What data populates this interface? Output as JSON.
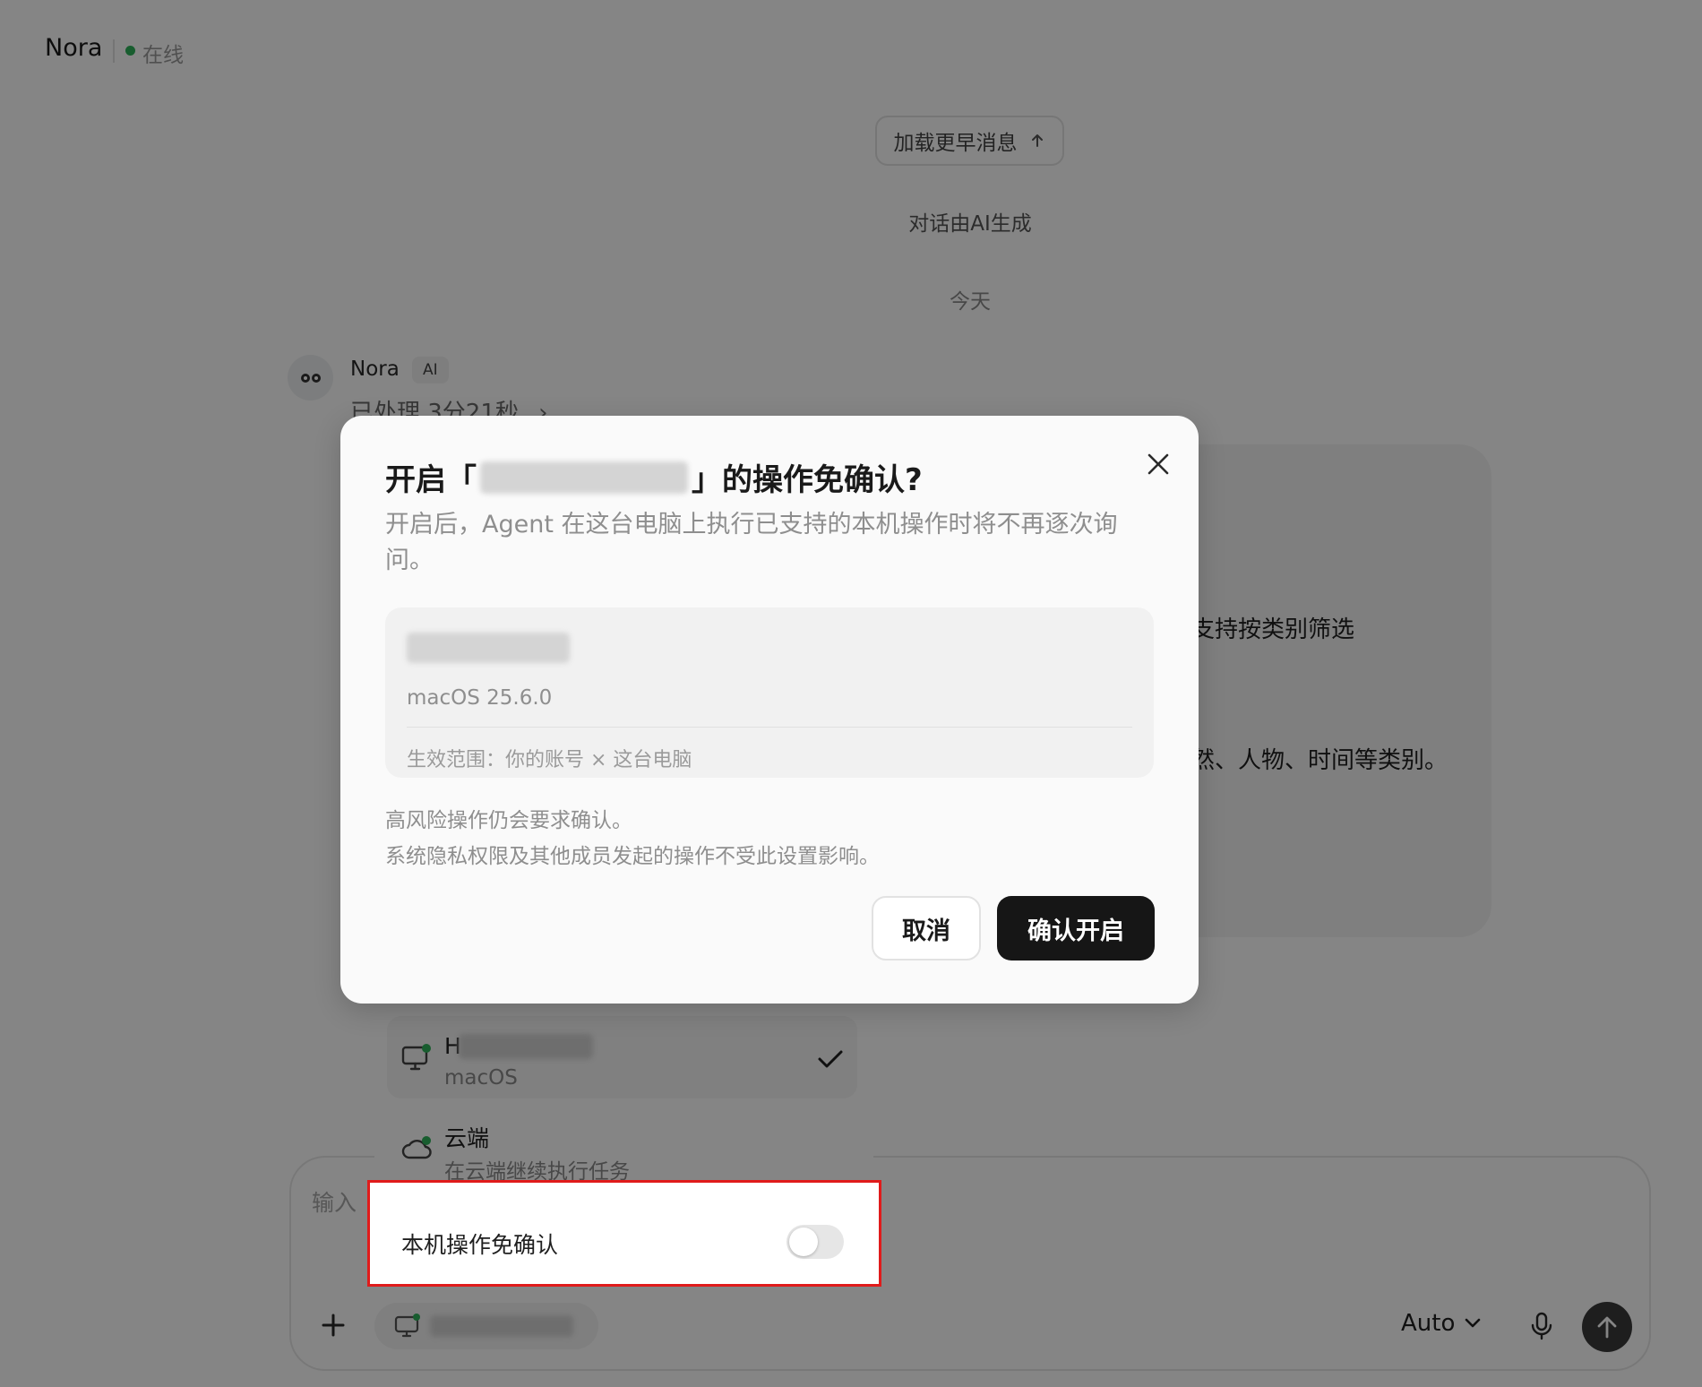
{
  "header": {
    "title": "Nora",
    "status": "在线",
    "status_color": "#2fb35a"
  },
  "chat": {
    "load_more_label": "加载更早消息",
    "ai_generated_note": "对话由AI生成",
    "date_separator": "今天",
    "message": {
      "sender": "Nora",
      "badge": "AI",
      "processed_time": "已处理 3分21秒",
      "bubble_lines": [
        "支持按类别筛选",
        "然、人物、时间等类别。"
      ]
    }
  },
  "device_menu": {
    "items": [
      {
        "title": "H",
        "subtitle": "macOS",
        "selected": true,
        "icon": "monitor-icon"
      },
      {
        "title": "云端",
        "subtitle": "在云端继续执行任务",
        "selected": false,
        "icon": "cloud-icon"
      }
    ],
    "toggle_label": "本机操作免确认",
    "toggle_on": false,
    "highlight_color": "#e01b1b"
  },
  "composer": {
    "placeholder": "输入",
    "model_select": "Auto"
  },
  "modal": {
    "title_prefix": "开启「",
    "title_suffix": "」的操作免确认?",
    "description": "开启后，Agent 在这台电脑上执行已支持的本机操作时将不再逐次询问。",
    "device_os": "macOS 25.6.0",
    "scope": "生效范围：你的账号 × 这台电脑",
    "note_line1": "高风险操作仍会要求确认。",
    "note_line2": "系统隐私权限及其他成员发起的操作不受此设置影响。",
    "cancel_label": "取消",
    "confirm_label": "确认开启",
    "confirm_color": "#161616"
  }
}
